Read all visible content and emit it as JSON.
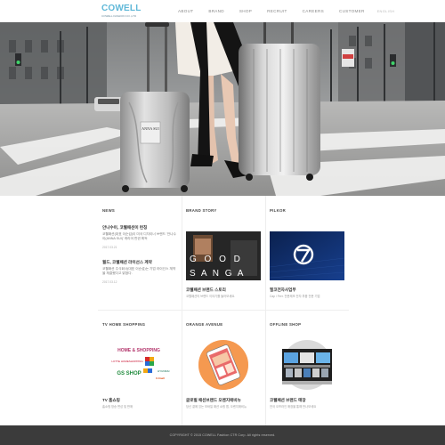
{
  "header": {
    "logo_text": "COWELL",
    "logo_sub": "COWELL FASHION CO.,LTD",
    "nav": [
      "ABOUT",
      "BRAND",
      "SHOP",
      "RECRUIT",
      "CAREERS",
      "CUSTOMER"
    ],
    "lang": "ENGLISH"
  },
  "hero": {
    "suitcase_tag": "ANNA SUI"
  },
  "news": {
    "title": "NEWS",
    "items": [
      {
        "title": "안나수이, 코웰패션이 런칭",
        "desc": "코웰패션(대표 이순섭)이 미국 디자이너 브랜드 '안나수이(ANNA SUI)' 캐리어 판권 획득",
        "date": "2017.03.21"
      },
      {
        "title": "월드, 코웰패션 라이선스 계약",
        "desc": "코웰패션 주식회사(대표 이순섭)는 기업 라이선스 계약을 체결했다고 밝혔다.",
        "date": "2017.03.12"
      }
    ]
  },
  "brand_story": {
    "title": "BRAND STORY",
    "thumb_line1": "G O O D",
    "thumb_line2": "S A N G A",
    "card_title": "코웰패션 브랜드 스토리",
    "card_desc": "코웰패션의 브랜드 이야기를 들어보세요."
  },
  "pilkor": {
    "title": "PILKOR",
    "card_title": "필코전자사업부",
    "card_desc": "Cap / Ferr. 전문제조 전자 부품 전문 기업"
  },
  "tv": {
    "title": "TV HOME SHOPPING",
    "card_title": "TV 홈쇼핑",
    "card_desc": "홈쇼핑 방송 편성 및 판매",
    "logos": [
      "HOME & SHOPPING",
      "LOTTE HOMESHOPPING",
      "GS SHOP",
      "HYUNDAI",
      "CJmall"
    ]
  },
  "orange": {
    "title": "ORANGE AVENUE",
    "card_title": "글로벌 패션브랜드 오렌지애비뉴",
    "card_desc": "당신 곁에 있는 모바일 패션 쇼핑 앱, 오렌지애비뉴"
  },
  "offline": {
    "title": "OFFLINE SHOP",
    "card_title": "코웰패션 브랜드 매장",
    "card_desc": "전국 오프라인 매장을 통해 만나보세요"
  },
  "footer": {
    "copyright": "COPYRIGHT © 2015 COWELL Fashion CTR Corp. All rights reserved."
  },
  "colors": {
    "logo_accent": "#5fb8d8",
    "footer_bg": "#3b3b3b",
    "pilkor_bg": "#0e2a66",
    "orange_accent": "#f08b3c",
    "gs_green": "#1f8a3c"
  }
}
